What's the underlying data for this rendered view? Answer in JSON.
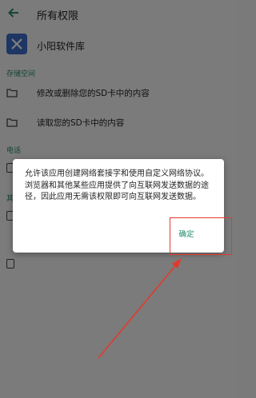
{
  "appbar": {
    "title": "所有权限",
    "back_icon": "arrow-left-icon"
  },
  "app": {
    "name": "小阳软件库",
    "icon": "x-logo-icon",
    "icon_color": "#3c6cc8"
  },
  "sections": {
    "storage": "存储空间",
    "phone": "电话",
    "other_partial": "其"
  },
  "storage_permissions": [
    {
      "label": "修改或删除您的SD卡中的内容",
      "icon": "folder-icon"
    },
    {
      "label": "读取您的SD卡中的内容",
      "icon": "folder-icon"
    }
  ],
  "dialog": {
    "message": "允许该应用创建网络套接字和使用自定义网络协议。浏览器和其他某些应用提供了向互联网发送数据的途径，因此应用无需该权限即可向互联网发送数据。",
    "confirm_label": "确定"
  },
  "colors": {
    "accent": "#1a8a6a",
    "annotation": "#e23a2e"
  }
}
